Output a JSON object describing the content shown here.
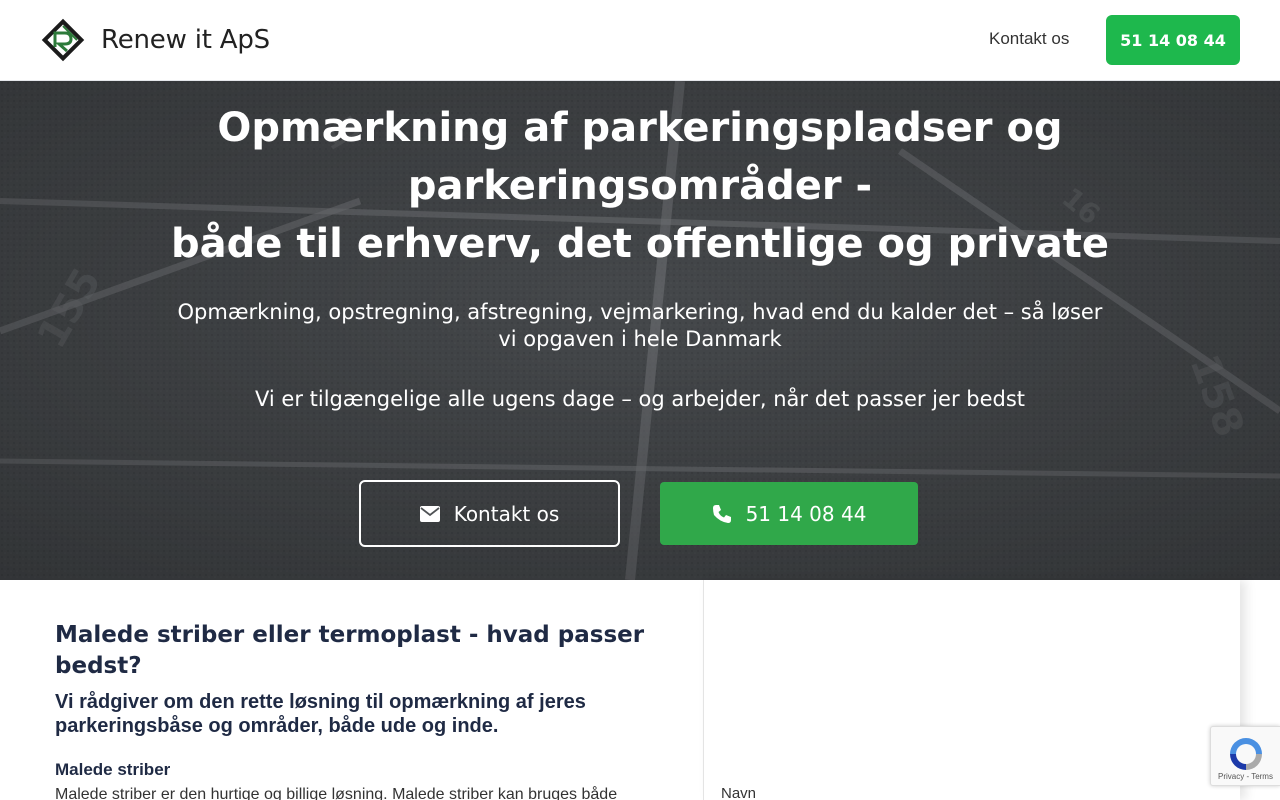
{
  "header": {
    "brand_name": "Renew it ApS",
    "nav_contact": "Kontakt os",
    "nav_phone": "51 14 08 44"
  },
  "hero": {
    "title_line1": "Opmærkning af parkeringspladser og",
    "title_line2": "parkeringsområder -",
    "title_line3": "både til erhverv, det offentlige og private",
    "subtitle": "Opmærkning, opstregning, afstregning, vejmarkering, hvad end du kalder det – så løser vi opgaven i hele Danmark",
    "subtitle2": "Vi er tilgængelige alle ugens dage – og arbejder, når det passer jer bedst",
    "contact_button": "Kontakt os",
    "phone_button": "51 14 08 44"
  },
  "content": {
    "section_title": "Malede striber eller termoplast - hvad passer bedst?",
    "section_lead": "Vi rådgiver om den rette løsning til opmærkning af jeres parkeringsbåse og områder, både ude og inde.",
    "sub_heading": "Malede striber",
    "sub_text": "Malede striber er den hurtige og billige løsning. Malede striber kan bruges både"
  },
  "form": {
    "name_label": "Navn"
  },
  "recaptcha": {
    "links": "Privacy - Terms"
  },
  "colors": {
    "accent_green": "#1eb84d",
    "hero_button_green": "#30a84a",
    "heading_navy": "#1f2a44"
  },
  "icons": {
    "contact": "envelope-icon",
    "phone": "phone-icon",
    "logo": "renew-logo",
    "recaptcha": "recaptcha-icon"
  }
}
